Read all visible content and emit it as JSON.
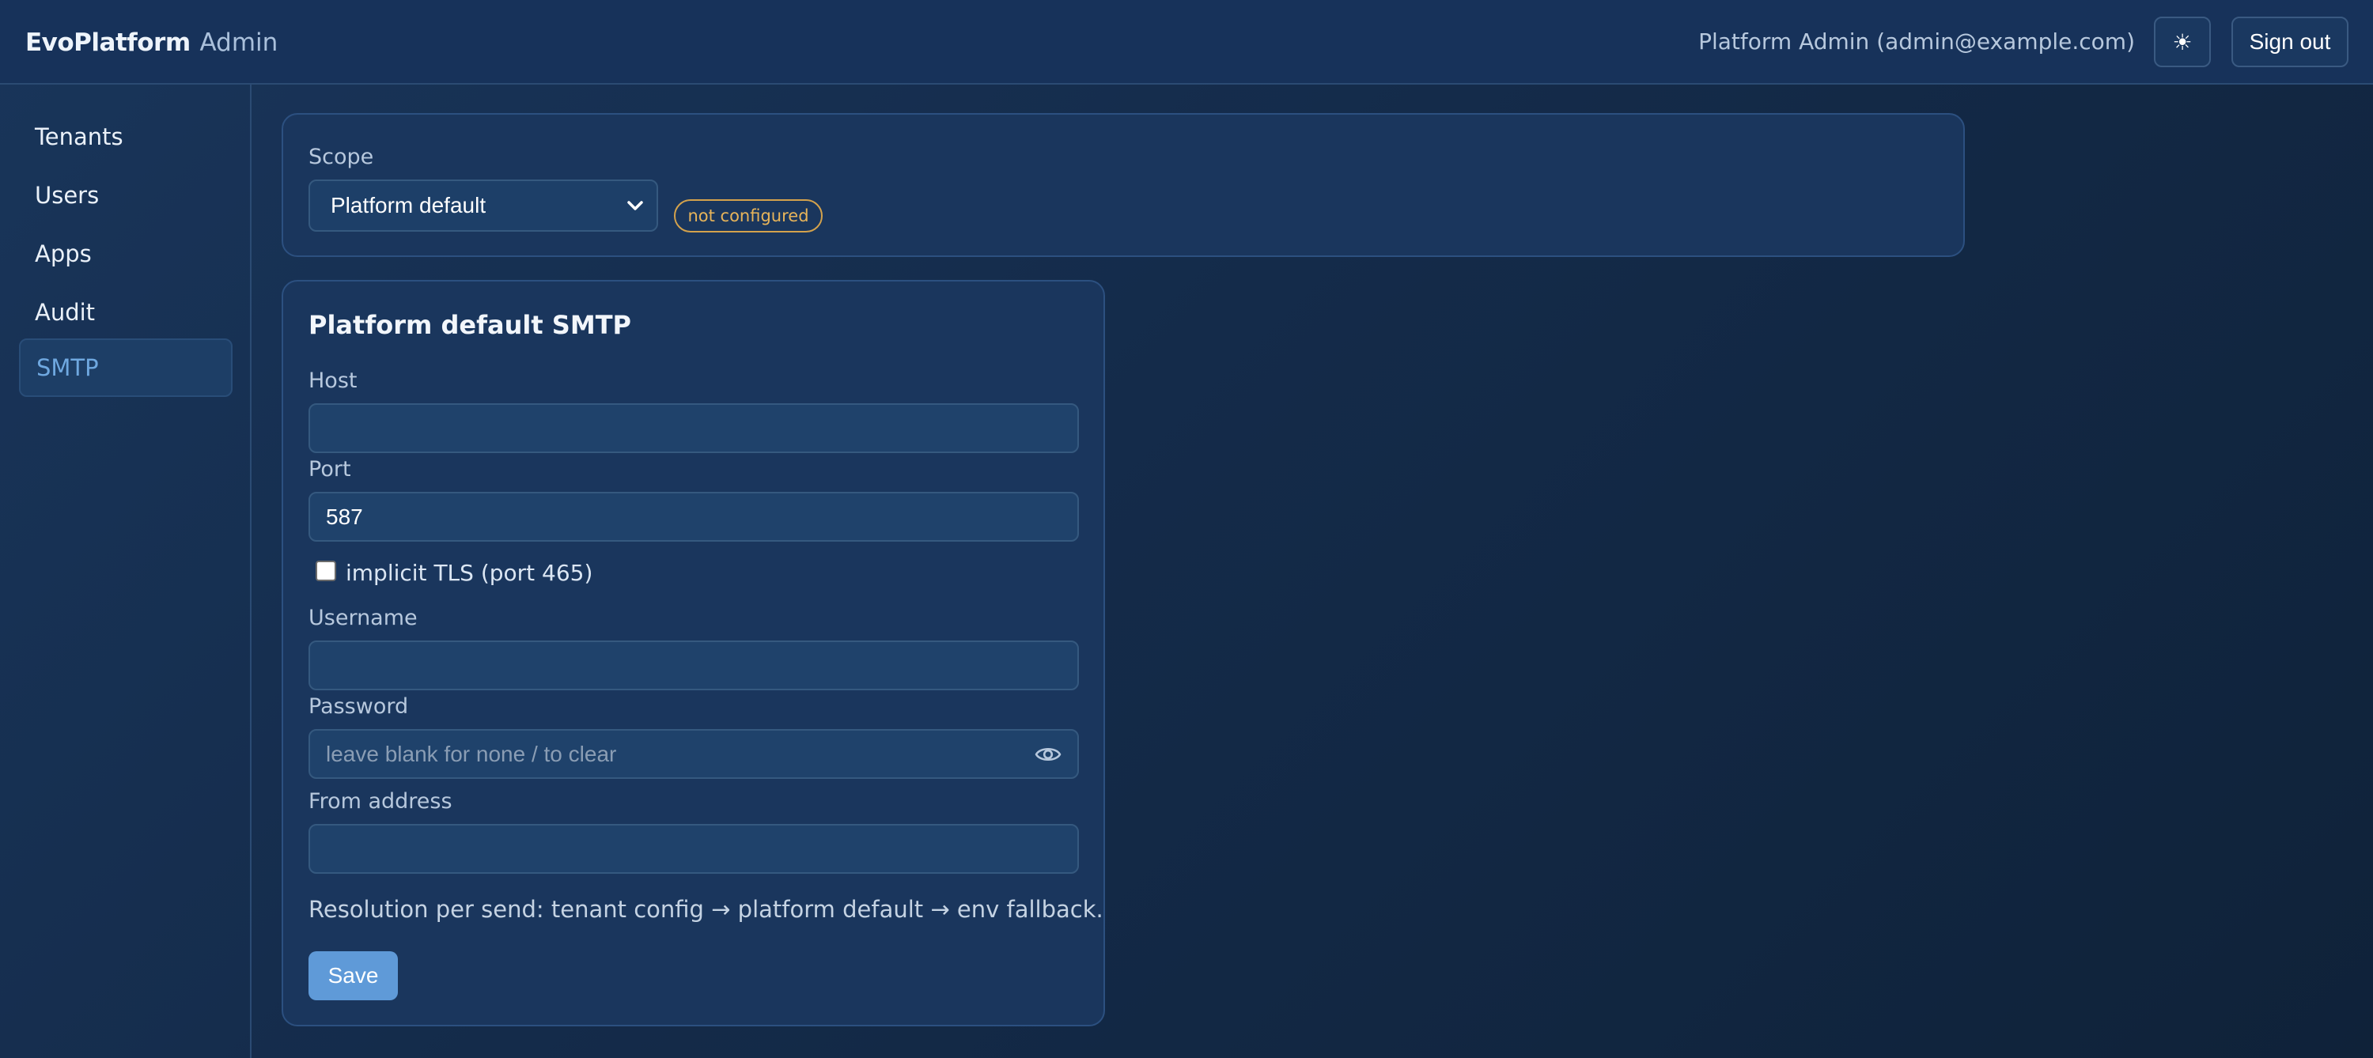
{
  "header": {
    "brand_main": "EvoPlatform",
    "brand_sub": "Admin",
    "user_label": "Platform Admin (admin@example.com)",
    "theme_icon": "sun-icon",
    "theme_glyph": "☀",
    "signout_label": "Sign out"
  },
  "sidebar": {
    "items": [
      {
        "label": "Tenants",
        "active": false
      },
      {
        "label": "Users",
        "active": false
      },
      {
        "label": "Apps",
        "active": false
      },
      {
        "label": "Audit",
        "active": false
      },
      {
        "label": "SMTP",
        "active": true
      }
    ]
  },
  "scope": {
    "label": "Scope",
    "selected": "Platform default",
    "status_badge": "not configured"
  },
  "smtp_form": {
    "title": "Platform default SMTP",
    "host": {
      "label": "Host",
      "value": ""
    },
    "port": {
      "label": "Port",
      "value": "587"
    },
    "implicit_tls": {
      "label": "implicit TLS (port 465)",
      "checked": false
    },
    "username": {
      "label": "Username",
      "value": ""
    },
    "password": {
      "label": "Password",
      "value": "",
      "placeholder": "leave blank for none / to clear"
    },
    "from_address": {
      "label": "From address",
      "value": ""
    },
    "note": "Resolution per send: tenant config → platform default → env fallback.",
    "save_label": "Save"
  },
  "colors": {
    "accent": "#5f9ad8",
    "active_nav_text": "#6fa8e0",
    "badge_warning": "#e7b45a",
    "background": "#142b4a"
  }
}
